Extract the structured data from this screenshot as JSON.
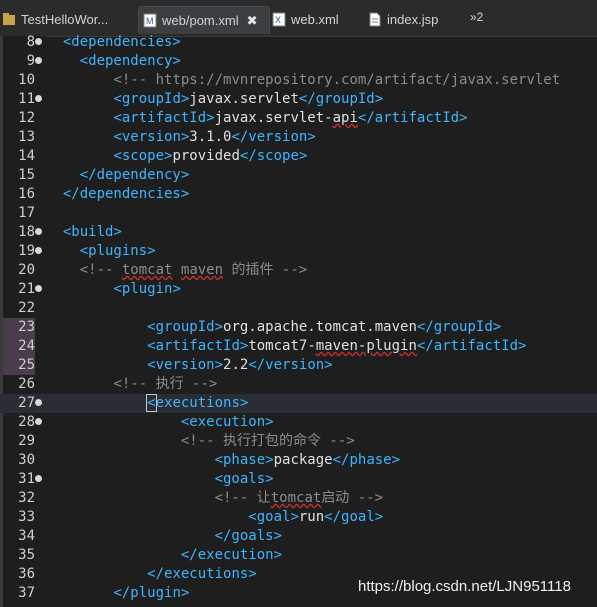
{
  "tabs": [
    {
      "label": "TestHelloWor...",
      "icon": "project-icon",
      "active": false
    },
    {
      "label": "web/pom.xml",
      "icon": "maven-pom-icon",
      "active": true,
      "close": "✖"
    },
    {
      "label": "web.xml",
      "icon": "xml-file-icon",
      "active": false
    },
    {
      "label": "index.jsp",
      "icon": "jsp-file-icon",
      "active": false
    }
  ],
  "overflow_label": "»2",
  "lines": [
    {
      "n": "8",
      "fold": true,
      "parts": [
        [
          "t",
          "<dependencies>"
        ]
      ],
      "indent": "  "
    },
    {
      "n": "9",
      "fold": true,
      "parts": [
        [
          "t",
          "<dependency>"
        ]
      ],
      "indent": "    "
    },
    {
      "n": "10",
      "fold": false,
      "parts": [
        [
          "c",
          "<!-- https://mvnrepository.com/artifact/javax.servlet"
        ]
      ],
      "indent": "        "
    },
    {
      "n": "11",
      "fold": true,
      "parts": [
        [
          "t",
          "<groupId>"
        ],
        [
          "v",
          "javax.servlet"
        ],
        [
          "t",
          "</groupId>"
        ]
      ],
      "indent": "        "
    },
    {
      "n": "12",
      "fold": false,
      "parts": [
        [
          "t",
          "<artifactId>"
        ],
        [
          "v",
          "javax.servlet-"
        ],
        [
          "vs",
          "api"
        ],
        [
          "t",
          "</artifactId>"
        ]
      ],
      "indent": "        "
    },
    {
      "n": "13",
      "fold": false,
      "parts": [
        [
          "t",
          "<version>"
        ],
        [
          "v",
          "3.1.0"
        ],
        [
          "t",
          "</version>"
        ]
      ],
      "indent": "        "
    },
    {
      "n": "14",
      "fold": false,
      "parts": [
        [
          "t",
          "<scope>"
        ],
        [
          "v",
          "provided"
        ],
        [
          "t",
          "</scope>"
        ]
      ],
      "indent": "        "
    },
    {
      "n": "15",
      "fold": false,
      "parts": [
        [
          "t",
          "</dependency>"
        ]
      ],
      "indent": "    "
    },
    {
      "n": "16",
      "fold": false,
      "parts": [
        [
          "t",
          "</dependencies>"
        ]
      ],
      "indent": "  "
    },
    {
      "n": "17",
      "fold": false,
      "parts": [],
      "indent": ""
    },
    {
      "n": "18",
      "fold": true,
      "parts": [
        [
          "t",
          "<build>"
        ]
      ],
      "indent": "  "
    },
    {
      "n": "19",
      "fold": true,
      "parts": [
        [
          "t",
          "<plugins>"
        ]
      ],
      "indent": "    "
    },
    {
      "n": "20",
      "fold": false,
      "parts": [
        [
          "c",
          "<!-- "
        ],
        [
          "cs",
          "tomcat"
        ],
        [
          "c",
          " "
        ],
        [
          "cs",
          "maven"
        ],
        [
          "c",
          " 的插件 -->"
        ]
      ],
      "indent": "    "
    },
    {
      "n": "21",
      "fold": true,
      "parts": [
        [
          "t",
          "<plugin>"
        ]
      ],
      "indent": "        "
    },
    {
      "n": "22",
      "fold": false,
      "parts": [],
      "indent": ""
    },
    {
      "n": "23",
      "fold": false,
      "hi": true,
      "parts": [
        [
          "t",
          "<groupId>"
        ],
        [
          "v",
          "org.apache.tomcat.maven"
        ],
        [
          "t",
          "</groupId>"
        ]
      ],
      "indent": "            "
    },
    {
      "n": "24",
      "fold": false,
      "hi": true,
      "parts": [
        [
          "t",
          "<artifactId>"
        ],
        [
          "v",
          "tomcat7-"
        ],
        [
          "vs",
          "maven-plugin"
        ],
        [
          "t",
          "</artifactId>"
        ]
      ],
      "indent": "            "
    },
    {
      "n": "25",
      "fold": false,
      "hi": true,
      "parts": [
        [
          "t",
          "<version>"
        ],
        [
          "v",
          "2.2"
        ],
        [
          "t",
          "</version>"
        ]
      ],
      "indent": "            "
    },
    {
      "n": "26",
      "fold": false,
      "parts": [
        [
          "c",
          "<!-- 执行 -->"
        ]
      ],
      "indent": "        "
    },
    {
      "n": "27",
      "fold": true,
      "cur": true,
      "parts": [
        [
          "tb",
          "<"
        ],
        [
          "t",
          "executions>"
        ]
      ],
      "indent": "            "
    },
    {
      "n": "28",
      "fold": true,
      "parts": [
        [
          "t",
          "<execution>"
        ]
      ],
      "indent": "                "
    },
    {
      "n": "29",
      "fold": false,
      "parts": [
        [
          "c",
          "<!-- 执行打包的命令 -->"
        ]
      ],
      "indent": "                "
    },
    {
      "n": "30",
      "fold": false,
      "parts": [
        [
          "t",
          "<phase>"
        ],
        [
          "v",
          "package"
        ],
        [
          "t",
          "</phase>"
        ]
      ],
      "indent": "                    "
    },
    {
      "n": "31",
      "fold": true,
      "parts": [
        [
          "t",
          "<goals>"
        ]
      ],
      "indent": "                    "
    },
    {
      "n": "32",
      "fold": false,
      "parts": [
        [
          "c",
          "<!-- 让"
        ],
        [
          "cs",
          "tomcat"
        ],
        [
          "c",
          "启动 -->"
        ]
      ],
      "indent": "                    "
    },
    {
      "n": "33",
      "fold": false,
      "parts": [
        [
          "t",
          "<goal>"
        ],
        [
          "v",
          "run"
        ],
        [
          "t",
          "</goal>"
        ]
      ],
      "indent": "                        "
    },
    {
      "n": "34",
      "fold": false,
      "parts": [
        [
          "t",
          "</goals>"
        ]
      ],
      "indent": "                    "
    },
    {
      "n": "35",
      "fold": false,
      "parts": [
        [
          "t",
          "</execution>"
        ]
      ],
      "indent": "                "
    },
    {
      "n": "36",
      "fold": false,
      "parts": [
        [
          "t",
          "</executions>"
        ]
      ],
      "indent": "            "
    },
    {
      "n": "37",
      "fold": false,
      "parts": [
        [
          "t",
          "</plugin>"
        ]
      ],
      "indent": "        "
    }
  ],
  "watermark": "https://blog.csdn.net/LJN951118"
}
